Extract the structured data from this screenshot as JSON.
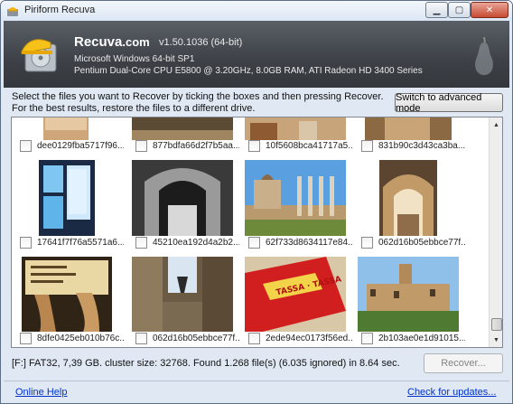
{
  "window": {
    "title": "Piriform Recuva",
    "buttons": {
      "minimize": "▁",
      "maximize": "▢",
      "close": "✕"
    }
  },
  "header": {
    "brand": "Recuva",
    "brand_suffix": ".com",
    "version": "v1.50.1036 (64-bit)",
    "os_line": "Microsoft Windows 64-bit SP1",
    "hw_line": "Pentium Dual-Core CPU E5800 @ 3.20GHz, 8.0GB RAM, ATI Radeon HD 3400 Series"
  },
  "instructions": {
    "line1": "Select the files you want to Recover by ticking the boxes and then pressing Recover.",
    "line2": "For the best results, restore the files to a different drive.",
    "advanced_button": "Switch to advanced mode"
  },
  "gallery": {
    "rows": [
      [
        {
          "name": "dee0129fba5717f96...",
          "checked": false
        },
        {
          "name": "877bdfa66d2f7b5aa...",
          "checked": false
        },
        {
          "name": "10f5608bca41717a5...",
          "checked": false
        },
        {
          "name": "831b90c3d43ca3ba...",
          "checked": false
        }
      ],
      [
        {
          "name": "17641f7f76a5571a6...",
          "checked": false
        },
        {
          "name": "45210ea192d4a2b2...",
          "checked": false
        },
        {
          "name": "62f733d8634117e84...",
          "checked": false
        },
        {
          "name": "062d16b05ebbce77f...",
          "checked": false
        }
      ],
      [
        {
          "name": "8dfe0425eb010b76c...",
          "checked": false
        },
        {
          "name": "062d16b05ebbce77f...",
          "checked": false
        },
        {
          "name": "2ede94ec0173f56ed...",
          "checked": false
        },
        {
          "name": "2b103ae0e1d91015...",
          "checked": false
        }
      ]
    ],
    "thumbnail_labels": {
      "book_title": "TASSA · TASSA"
    }
  },
  "status": {
    "text": "[F:] FAT32, 7,39 GB. cluster size: 32768. Found 1.268 file(s) (6.035 ignored) in 8.64 sec.",
    "recover_button": "Recover..."
  },
  "footer": {
    "online_help": "Online Help",
    "check_updates": "Check for updates..."
  },
  "colors": {
    "banner": "#3d4147",
    "link": "#0033cc",
    "window_bg": "#dfe8f3"
  }
}
